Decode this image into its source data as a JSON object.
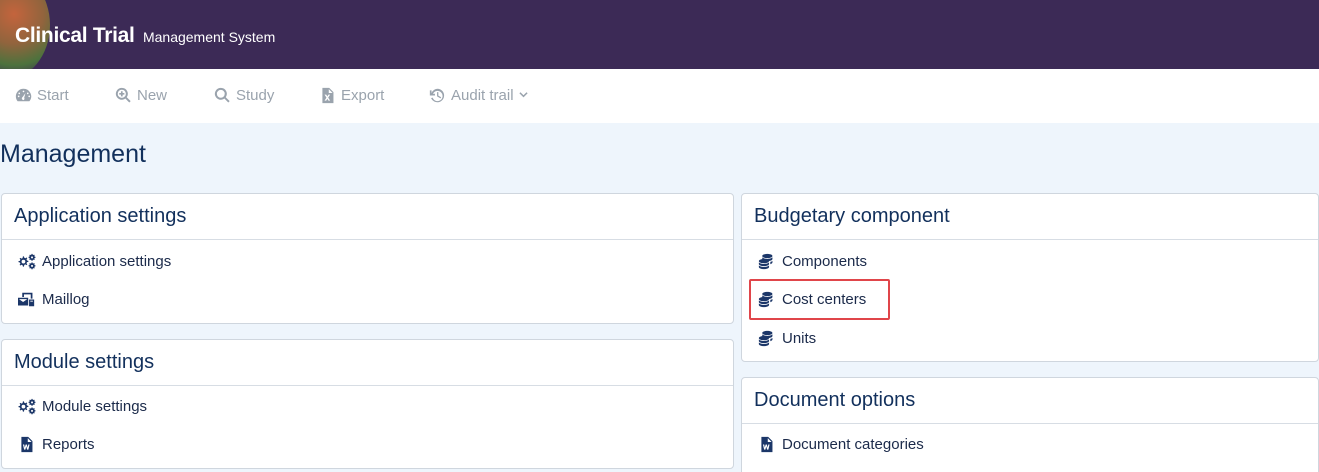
{
  "header": {
    "brand_main": "Clinical Trial",
    "brand_sub": "Management System"
  },
  "nav": {
    "start": "Start",
    "new": "New",
    "study": "Study",
    "export": "Export",
    "audit_trail": "Audit trail"
  },
  "page": {
    "title": "Management"
  },
  "panels": {
    "application_settings": {
      "title": "Application settings",
      "items": [
        "Application settings",
        "Maillog"
      ]
    },
    "module_settings": {
      "title": "Module settings",
      "items": [
        "Module settings",
        "Reports"
      ]
    },
    "budgetary_component": {
      "title": "Budgetary component",
      "items": [
        "Components",
        "Cost centers",
        "Units"
      ]
    },
    "document_options": {
      "title": "Document options",
      "items": [
        "Document categories"
      ]
    }
  },
  "colors": {
    "header_bg": "#3c2a56",
    "highlight": "#e0454a",
    "title": "#12305c"
  }
}
